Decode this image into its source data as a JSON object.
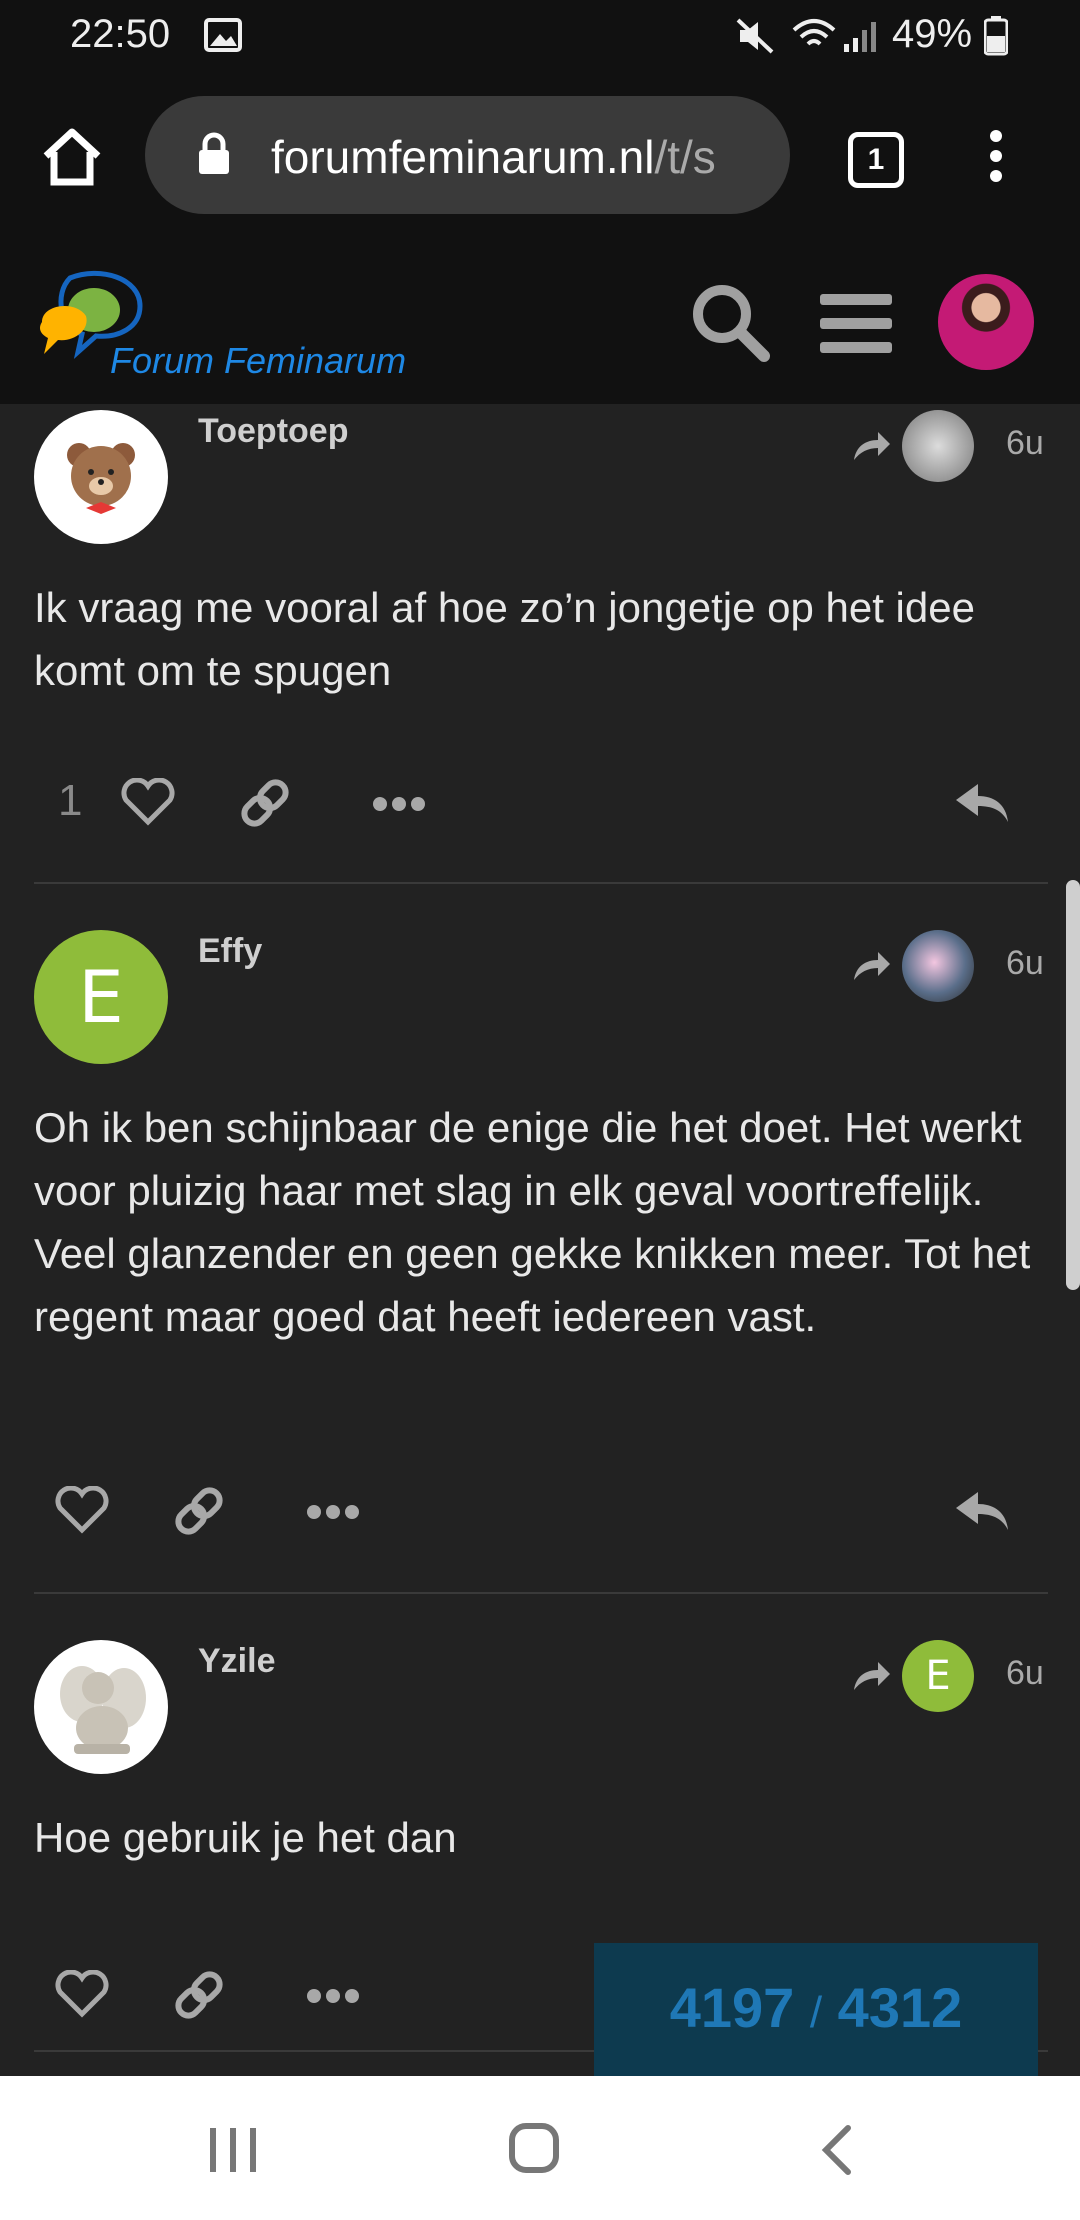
{
  "status_bar": {
    "time": "22:50",
    "battery": "49%"
  },
  "browser": {
    "url_main": "forumfeminarum.nl",
    "url_rest": "/t/s",
    "tab_count": "1"
  },
  "site": {
    "brand": "Forum Feminarum"
  },
  "posts": [
    {
      "username": "Toeptoep",
      "age": "6u",
      "body": "Ik vraag me vooral af hoe zo’n jongetje op het idee komt om te spugen",
      "like_count": "1"
    },
    {
      "username": "Effy",
      "avatar_letter": "E",
      "age": "6u",
      "body": "Oh ik ben schijnbaar de enige die het doet. Het werkt voor pluizig haar met slag in elk geval voortreffelijk. Veel glanzender en geen gekke knikken meer. Tot het regent maar goed dat heeft iedereen vast."
    },
    {
      "username": "Yzile",
      "age": "6u",
      "reply_to_letter": "E",
      "body": "Hoe gebruik je het dan"
    }
  ],
  "progress": {
    "current": "4197",
    "separator": "/",
    "total": "4312"
  },
  "colors": {
    "background": "#222222",
    "header": "#111111",
    "accent": "#1f78b6",
    "avatar_green": "#8fbc3a"
  }
}
